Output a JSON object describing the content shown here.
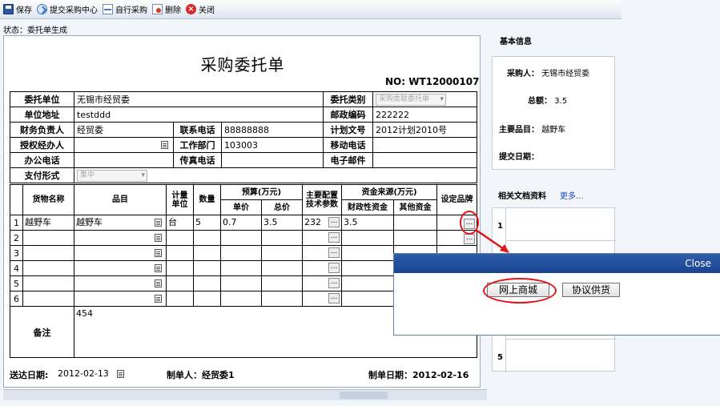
{
  "toolbar": {
    "save": "保存",
    "submit": "提交采购中心",
    "self_purchase": "自行采购",
    "delete": "删除",
    "close": "关闭"
  },
  "status": "状态：委托单生成",
  "doc": {
    "title": "采购委托单",
    "number": "NO: WT12000107",
    "labels": {
      "client": "委托单位",
      "category": "委托类别",
      "address": "单位地址",
      "postcode": "邮政编码",
      "finance_head": "财务负责人",
      "phone": "联系电话",
      "plan_no": "计划文号",
      "agent": "授权经办人",
      "department": "工作部门",
      "mobile": "移动电话",
      "office_phone": "办公电话",
      "fax": "传真电话",
      "email": "电子邮件",
      "payment": "支付形式"
    },
    "values": {
      "client": "无锡市经贸委",
      "category": "采购类联委托单",
      "address": "testddd",
      "postcode": "222222",
      "finance_head": "经贸委",
      "phone": "88888888",
      "plan_no": "2012计划2010号",
      "department": "103003",
      "payment": "集中"
    },
    "goods_headers": {
      "goods_name": "货物名称",
      "item": "品目",
      "unit": "计量单位",
      "qty": "数量",
      "budget": "预算(万元)",
      "unit_price": "单价",
      "total": "总价",
      "spec": "主要配置技术参数",
      "fund_source": "资金来源(万元)",
      "fiscal": "财政性资金",
      "other": "其他资金",
      "brand": "设定品牌"
    },
    "rows": [
      {
        "no": "1",
        "name": "越野车",
        "item": "越野车",
        "unit": "台",
        "qty": "5",
        "price": "0.7",
        "total": "3.5",
        "spec": "232",
        "fiscal": "3.5",
        "other": "",
        "brand_btn": "..."
      },
      {
        "no": "2",
        "name": "",
        "item": "",
        "unit": "",
        "qty": "",
        "price": "",
        "total": "",
        "spec": "",
        "fiscal": "",
        "other": "",
        "brand_btn": "..."
      },
      {
        "no": "3",
        "name": "",
        "item": "",
        "unit": "",
        "qty": "",
        "price": "",
        "total": "",
        "spec": "",
        "fiscal": "",
        "other": "",
        "brand_btn": ""
      },
      {
        "no": "4",
        "name": "",
        "item": "",
        "unit": "",
        "qty": "",
        "price": "",
        "total": "",
        "spec": "",
        "fiscal": "",
        "other": "",
        "brand_btn": ""
      },
      {
        "no": "5",
        "name": "",
        "item": "",
        "unit": "",
        "qty": "",
        "price": "",
        "total": "",
        "spec": "",
        "fiscal": "",
        "other": "",
        "brand_btn": ""
      },
      {
        "no": "6",
        "name": "",
        "item": "",
        "unit": "",
        "qty": "",
        "price": "",
        "total": "",
        "spec": "",
        "fiscal": "",
        "other": "",
        "brand_btn": ""
      }
    ],
    "spec_btn": "...",
    "remark_label": "备注",
    "remark_value": "454",
    "delivery_label": "送达日期:",
    "delivery_date": "2012-02-13",
    "creator": "制单人：经贸委1",
    "created_date": "制单日期：2012-02-16"
  },
  "right_panel": {
    "basic_info": "基本信息",
    "buyer_label": "采购人：",
    "buyer": "无锡市经贸委",
    "total_label": "总额：",
    "total": "3.5",
    "main_item_label": "主要品目：",
    "main_item": "越野车",
    "submit_date_label": "提交日期：",
    "docs_title": "相关文档资料",
    "more": "更多...",
    "list_nums": [
      "1",
      "5"
    ]
  },
  "popup": {
    "close": "Close",
    "btn_online": "网上商城",
    "btn_agreement": "协议供货"
  },
  "colors": {
    "accent_blue": "#1b4491",
    "highlight_red": "#e3141b"
  }
}
